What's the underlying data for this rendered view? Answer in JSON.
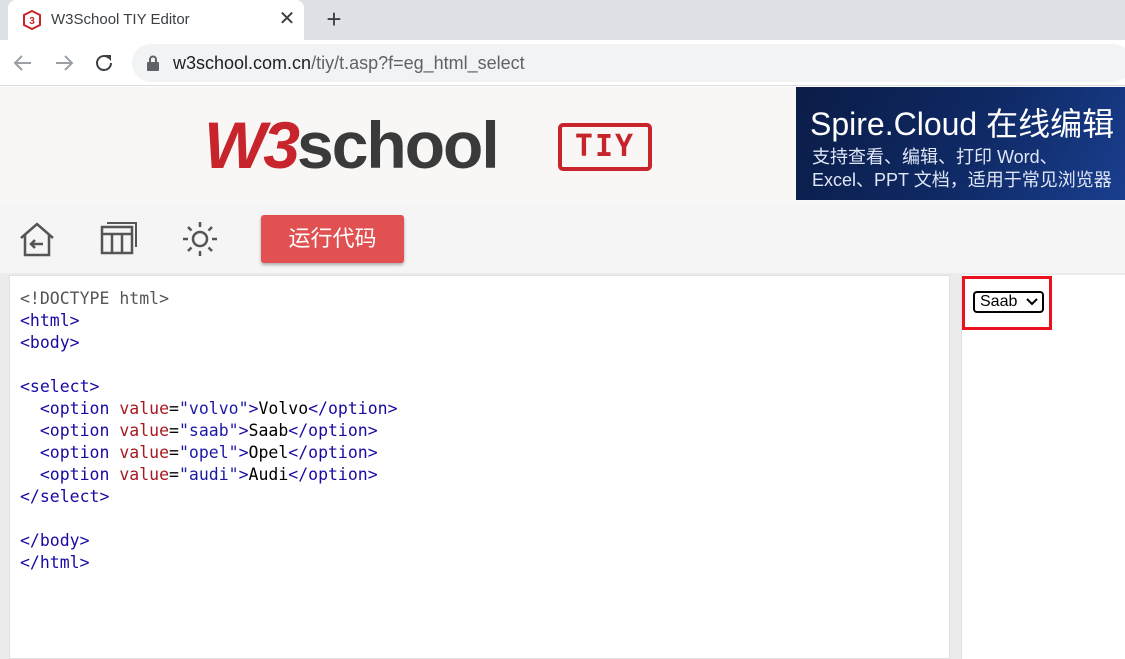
{
  "browser": {
    "tab_title": "W3School TIY Editor",
    "tab_close": "✕",
    "new_tab": "+",
    "url_host": "w3school.com.cn",
    "url_path": "/tiy/t.asp?f=eg_html_select"
  },
  "header": {
    "logo_w3": "W3",
    "logo_school": "school",
    "tiy_label": "TIY",
    "ad": {
      "title": "Spire.Cloud 在线编辑",
      "line1": "支持查看、编辑、打印 Word、",
      "line2": "Excel、PPT 文档，适用于常见浏览器"
    },
    "brand_color": "#c8242b"
  },
  "toolbar": {
    "icons": [
      "home-back-icon",
      "layout-icon",
      "brightness-icon"
    ],
    "run_label": "运行代码",
    "run_color": "#e25151"
  },
  "editor": {
    "lines": [
      [
        {
          "t": "doc",
          "v": "<!DOCTYPE html>"
        }
      ],
      [
        {
          "t": "tag",
          "v": "<html>"
        }
      ],
      [
        {
          "t": "tag",
          "v": "<body>"
        }
      ],
      [],
      [
        {
          "t": "tag",
          "v": "<select>"
        }
      ],
      [
        {
          "t": "text",
          "v": "  "
        },
        {
          "t": "tag",
          "v": "<option "
        },
        {
          "t": "attr",
          "v": "value"
        },
        {
          "t": "text",
          "v": "="
        },
        {
          "t": "val",
          "v": "\"volvo\""
        },
        {
          "t": "tag",
          "v": ">"
        },
        {
          "t": "text",
          "v": "Volvo"
        },
        {
          "t": "tag",
          "v": "</option>"
        }
      ],
      [
        {
          "t": "text",
          "v": "  "
        },
        {
          "t": "tag",
          "v": "<option "
        },
        {
          "t": "attr",
          "v": "value"
        },
        {
          "t": "text",
          "v": "="
        },
        {
          "t": "val",
          "v": "\"saab\""
        },
        {
          "t": "tag",
          "v": ">"
        },
        {
          "t": "text",
          "v": "Saab"
        },
        {
          "t": "tag",
          "v": "</option>"
        }
      ],
      [
        {
          "t": "text",
          "v": "  "
        },
        {
          "t": "tag",
          "v": "<option "
        },
        {
          "t": "attr",
          "v": "value"
        },
        {
          "t": "text",
          "v": "="
        },
        {
          "t": "val",
          "v": "\"opel\""
        },
        {
          "t": "tag",
          "v": ">"
        },
        {
          "t": "text",
          "v": "Opel"
        },
        {
          "t": "tag",
          "v": "</option>"
        }
      ],
      [
        {
          "t": "text",
          "v": "  "
        },
        {
          "t": "tag",
          "v": "<option "
        },
        {
          "t": "attr",
          "v": "value"
        },
        {
          "t": "text",
          "v": "="
        },
        {
          "t": "val",
          "v": "\"audi\""
        },
        {
          "t": "tag",
          "v": ">"
        },
        {
          "t": "text",
          "v": "Audi"
        },
        {
          "t": "tag",
          "v": "</option>"
        }
      ],
      [
        {
          "t": "tag",
          "v": "</select>"
        }
      ],
      [],
      [
        {
          "t": "tag",
          "v": "</body>"
        }
      ],
      [
        {
          "t": "tag",
          "v": "</html>"
        }
      ]
    ]
  },
  "result": {
    "select_value": "Saab",
    "highlight_color": "#e8111d"
  }
}
